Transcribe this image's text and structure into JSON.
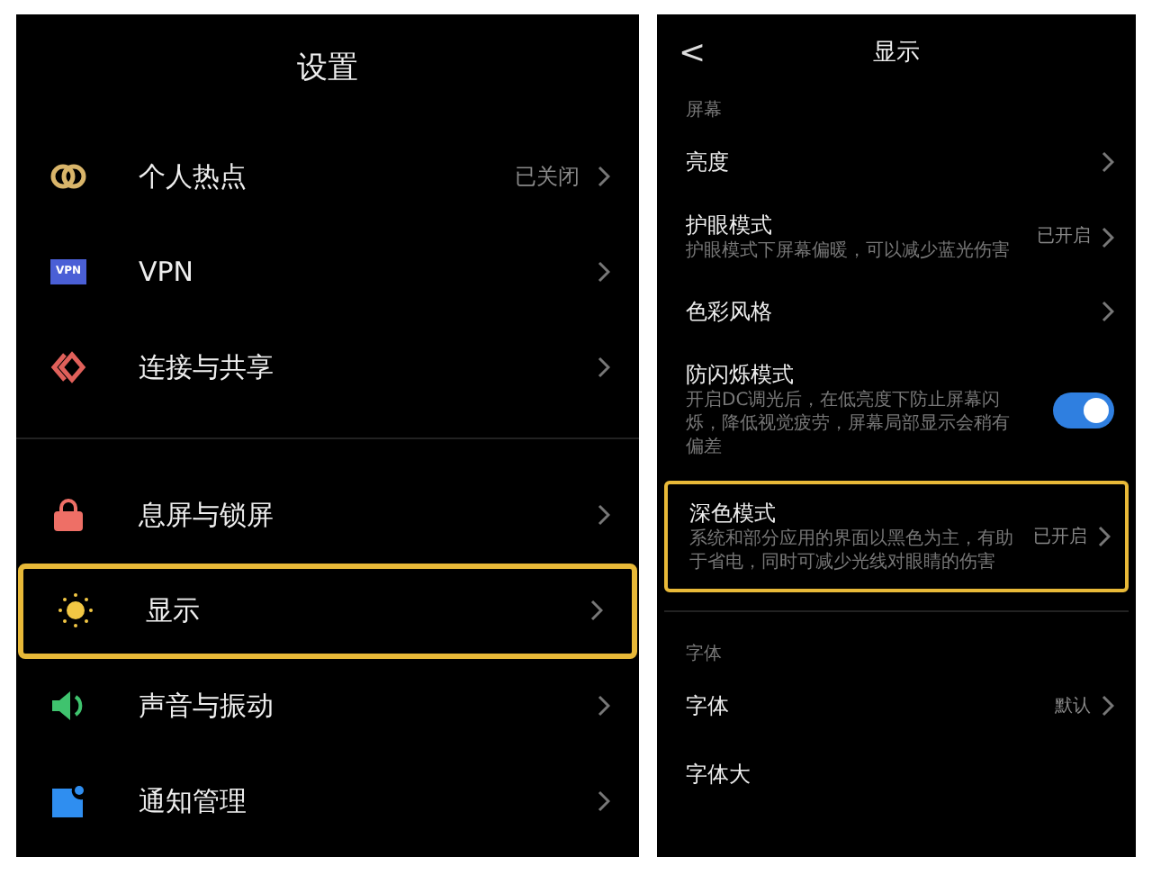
{
  "settings": {
    "title": "设置",
    "groups": [
      {
        "items": [
          {
            "kind": "hotspot",
            "label": "个人热点",
            "value": "已关闭",
            "highlighted": false
          },
          {
            "kind": "vpn",
            "icon_text": "VPN",
            "label": "VPN",
            "highlighted": false
          },
          {
            "kind": "share",
            "label": "连接与共享",
            "highlighted": false
          }
        ]
      },
      {
        "items": [
          {
            "kind": "lock",
            "label": "息屏与锁屏",
            "highlighted": false
          },
          {
            "kind": "sun",
            "label": "显示",
            "highlighted": true
          },
          {
            "kind": "sound",
            "label": "声音与振动",
            "highlighted": false
          },
          {
            "kind": "notify",
            "label": "通知管理",
            "highlighted": false
          }
        ]
      }
    ]
  },
  "display": {
    "back": "<",
    "title": "显示",
    "sections": [
      {
        "heading": "屏幕",
        "items": [
          {
            "kind": "nav",
            "label": "亮度",
            "highlighted": false
          },
          {
            "kind": "nav",
            "label": "护眼模式",
            "description": "护眼模式下屏幕偏暖，可以减少蓝光伤害",
            "value": "已开启",
            "highlighted": false
          },
          {
            "kind": "nav",
            "label": "色彩风格",
            "highlighted": false
          },
          {
            "kind": "toggle",
            "label": "防闪烁模式",
            "description": "开启DC调光后，在低亮度下防止屏幕闪烁，降低视觉疲劳，屏幕局部显示会稍有偏差",
            "on": true,
            "highlighted": false
          },
          {
            "kind": "nav",
            "label": "深色模式",
            "description": "系统和部分应用的界面以黑色为主，有助于省电，同时可减少光线对眼睛的伤害",
            "value": "已开启",
            "highlighted": true
          }
        ]
      },
      {
        "heading": "字体",
        "items": [
          {
            "kind": "nav",
            "label": "字体",
            "value": "默认",
            "highlighted": false
          },
          {
            "kind": "partial",
            "label": "字体大",
            "highlighted": false
          }
        ]
      }
    ]
  }
}
